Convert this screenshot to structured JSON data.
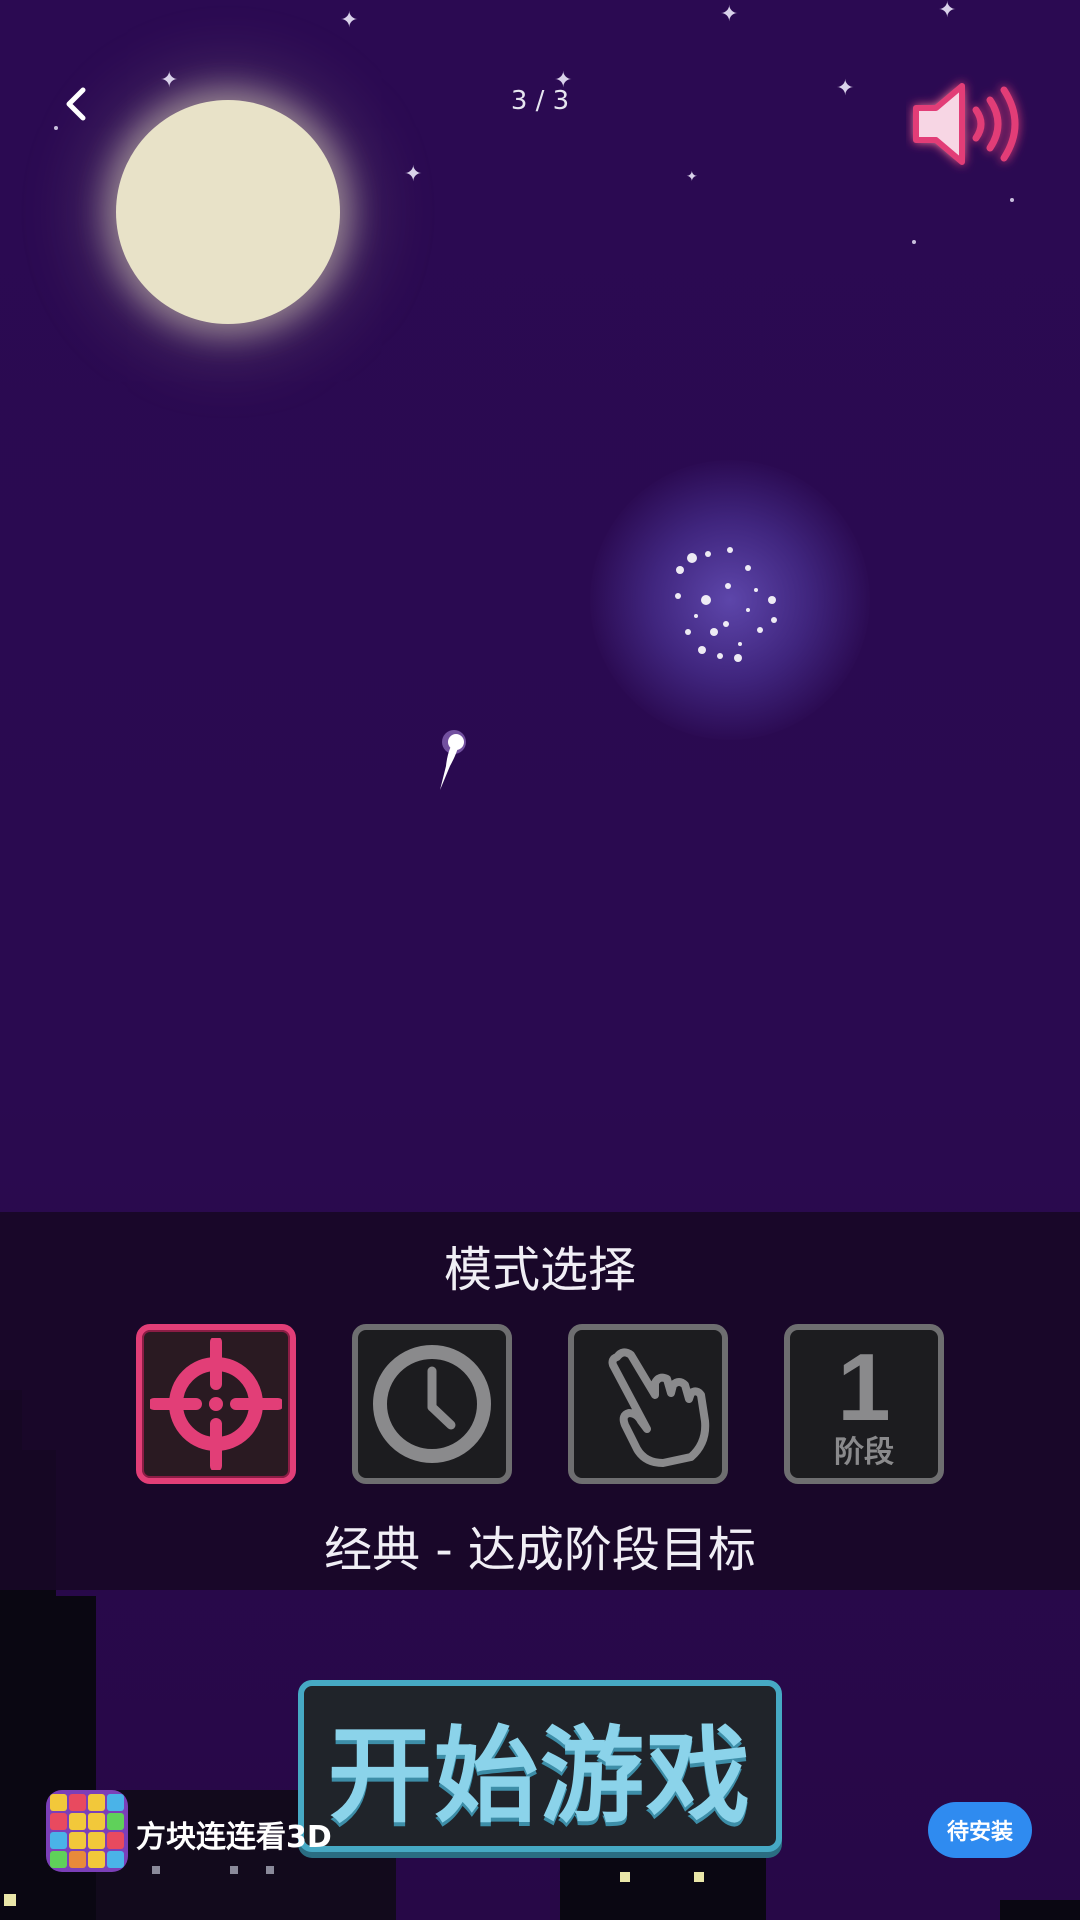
{
  "header": {
    "page_counter": "3 / 3",
    "back_icon": "chevron-left-icon",
    "sound_icon": "speaker-on-icon"
  },
  "mode_select": {
    "title": "模式选择",
    "modes": [
      {
        "id": "classic",
        "icon": "crosshair-icon",
        "active": true
      },
      {
        "id": "timed",
        "icon": "clock-icon",
        "active": false
      },
      {
        "id": "tap",
        "icon": "pointing-hand-icon",
        "active": false
      },
      {
        "id": "stage",
        "icon": "stage-number-icon",
        "number": "1",
        "label": "阶段",
        "active": false
      }
    ],
    "description": "经典 - 达成阶段目标"
  },
  "start_button": {
    "label": "开始游戏"
  },
  "ad": {
    "app_name": "方块连连看3D",
    "install_label": "待安装"
  },
  "colors": {
    "background": "#2a0a50",
    "active_mode": "#e23e77",
    "inactive_mode": "#6e6e70",
    "start_text": "#8bd3ea",
    "start_border": "#46a9c4",
    "install_button": "#2f8bf0"
  }
}
